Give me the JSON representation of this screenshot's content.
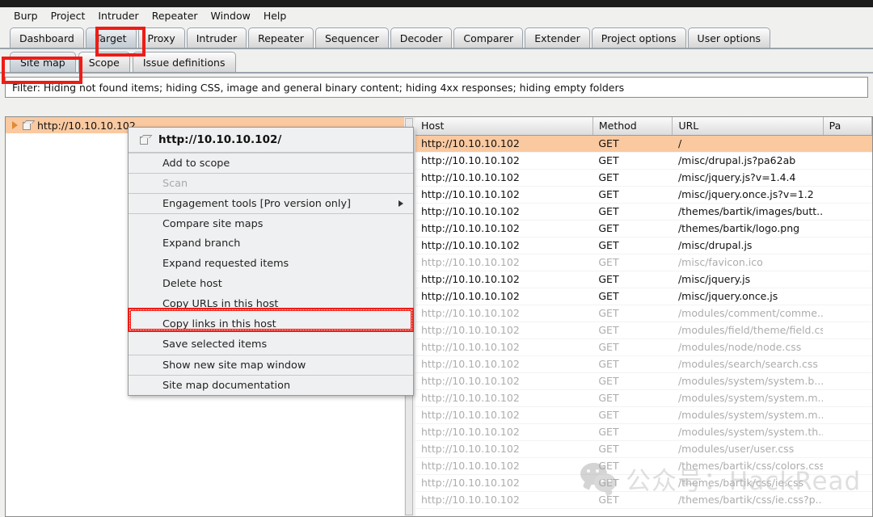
{
  "app": {
    "title_bar_color": "#1d1d1d"
  },
  "menubar": {
    "items": [
      {
        "label": "Burp"
      },
      {
        "label": "Project"
      },
      {
        "label": "Intruder"
      },
      {
        "label": "Repeater"
      },
      {
        "label": "Window"
      },
      {
        "label": "Help"
      }
    ]
  },
  "main_tabs": {
    "selected": "Target",
    "items": [
      {
        "label": "Dashboard"
      },
      {
        "label": "Target"
      },
      {
        "label": "Proxy"
      },
      {
        "label": "Intruder"
      },
      {
        "label": "Repeater"
      },
      {
        "label": "Sequencer"
      },
      {
        "label": "Decoder"
      },
      {
        "label": "Comparer"
      },
      {
        "label": "Extender"
      },
      {
        "label": "Project options"
      },
      {
        "label": "User options"
      }
    ]
  },
  "sub_tabs": {
    "selected": "Site map",
    "items": [
      {
        "label": "Site map"
      },
      {
        "label": "Scope"
      },
      {
        "label": "Issue definitions"
      }
    ]
  },
  "filter": {
    "text": "Filter: Hiding not found items;  hiding CSS, image and general binary content;  hiding 4xx responses;  hiding empty folders"
  },
  "tree": {
    "root_label": "http://10.10.10.102"
  },
  "context_menu": {
    "header": "http://10.10.10.102/",
    "items": [
      {
        "label": "Add to scope",
        "disabled": false,
        "separator": true,
        "submenu": false
      },
      {
        "label": "Scan",
        "disabled": true,
        "separator": true,
        "submenu": false
      },
      {
        "label": "Engagement tools [Pro version only]",
        "disabled": false,
        "separator": true,
        "submenu": true
      },
      {
        "label": "Compare site maps",
        "disabled": false,
        "separator": true,
        "submenu": false
      },
      {
        "label": "Expand branch",
        "disabled": false,
        "separator": false,
        "submenu": false
      },
      {
        "label": "Expand requested items",
        "disabled": false,
        "separator": false,
        "submenu": false
      },
      {
        "label": "Delete host",
        "disabled": false,
        "separator": false,
        "submenu": false
      },
      {
        "label": "Copy URLs in this host",
        "disabled": false,
        "separator": false,
        "submenu": false
      },
      {
        "label": "Copy links in this host",
        "disabled": false,
        "separator": false,
        "submenu": false
      },
      {
        "label": "Save selected items",
        "disabled": false,
        "separator": false,
        "submenu": false
      },
      {
        "label": "Show new site map window",
        "disabled": false,
        "separator": true,
        "submenu": false
      },
      {
        "label": "Site map documentation",
        "disabled": false,
        "separator": true,
        "submenu": false
      }
    ],
    "highlighted_item": "Copy links in this host"
  },
  "table": {
    "columns": [
      {
        "label": "Host"
      },
      {
        "label": "Method"
      },
      {
        "label": "URL"
      },
      {
        "label": "Pa"
      }
    ],
    "rows": [
      {
        "host": "http://10.10.10.102",
        "method": "GET",
        "url": "/",
        "selected": true,
        "dim": false
      },
      {
        "host": "http://10.10.10.102",
        "method": "GET",
        "url": "/misc/drupal.js?pa62ab",
        "selected": false,
        "dim": false
      },
      {
        "host": "http://10.10.10.102",
        "method": "GET",
        "url": "/misc/jquery.js?v=1.4.4",
        "selected": false,
        "dim": false
      },
      {
        "host": "http://10.10.10.102",
        "method": "GET",
        "url": "/misc/jquery.once.js?v=1.2",
        "selected": false,
        "dim": false
      },
      {
        "host": "http://10.10.10.102",
        "method": "GET",
        "url": "/themes/bartik/images/butt...",
        "selected": false,
        "dim": false
      },
      {
        "host": "http://10.10.10.102",
        "method": "GET",
        "url": "/themes/bartik/logo.png",
        "selected": false,
        "dim": false
      },
      {
        "host": "http://10.10.10.102",
        "method": "GET",
        "url": "/misc/drupal.js",
        "selected": false,
        "dim": false
      },
      {
        "host": "http://10.10.10.102",
        "method": "GET",
        "url": "/misc/favicon.ico",
        "selected": false,
        "dim": true
      },
      {
        "host": "http://10.10.10.102",
        "method": "GET",
        "url": "/misc/jquery.js",
        "selected": false,
        "dim": false
      },
      {
        "host": "http://10.10.10.102",
        "method": "GET",
        "url": "/misc/jquery.once.js",
        "selected": false,
        "dim": false
      },
      {
        "host": "http://10.10.10.102",
        "method": "GET",
        "url": "/modules/comment/comme...",
        "selected": false,
        "dim": true
      },
      {
        "host": "http://10.10.10.102",
        "method": "GET",
        "url": "/modules/field/theme/field.css",
        "selected": false,
        "dim": true
      },
      {
        "host": "http://10.10.10.102",
        "method": "GET",
        "url": "/modules/node/node.css",
        "selected": false,
        "dim": true
      },
      {
        "host": "http://10.10.10.102",
        "method": "GET",
        "url": "/modules/search/search.css",
        "selected": false,
        "dim": true
      },
      {
        "host": "http://10.10.10.102",
        "method": "GET",
        "url": "/modules/system/system.b...",
        "selected": false,
        "dim": true
      },
      {
        "host": "http://10.10.10.102",
        "method": "GET",
        "url": "/modules/system/system.m...",
        "selected": false,
        "dim": true
      },
      {
        "host": "http://10.10.10.102",
        "method": "GET",
        "url": "/modules/system/system.m...",
        "selected": false,
        "dim": true
      },
      {
        "host": "http://10.10.10.102",
        "method": "GET",
        "url": "/modules/system/system.th...",
        "selected": false,
        "dim": true
      },
      {
        "host": "http://10.10.10.102",
        "method": "GET",
        "url": "/modules/user/user.css",
        "selected": false,
        "dim": true
      },
      {
        "host": "http://10.10.10.102",
        "method": "GET",
        "url": "/themes/bartik/css/colors.css",
        "selected": false,
        "dim": true
      },
      {
        "host": "http://10.10.10.102",
        "method": "GET",
        "url": "/themes/bartik/css/ie.css",
        "selected": false,
        "dim": true
      },
      {
        "host": "http://10.10.10.102",
        "method": "GET",
        "url": "/themes/bartik/css/ie.css?p...",
        "selected": false,
        "dim": true
      }
    ]
  },
  "watermark": {
    "text": "公众号：HackRead"
  },
  "colors": {
    "selection": "#fac9a0",
    "annotation_red": "#ee1c16",
    "tab_border": "#9aa3ab"
  }
}
